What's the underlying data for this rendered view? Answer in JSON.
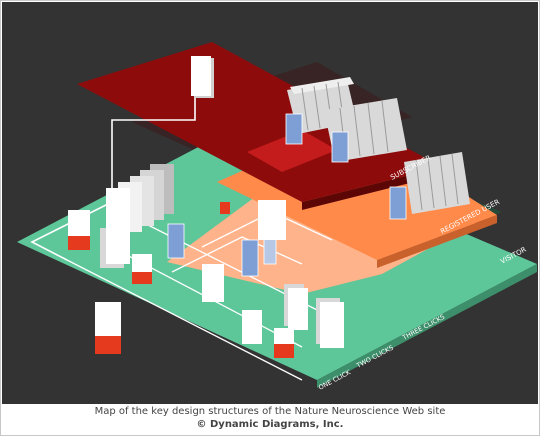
{
  "levels": {
    "visitor": "VISITOR",
    "registered": "REGISTERED USER",
    "subscriber": "SUBSCRIBER"
  },
  "click_depth": {
    "one": "ONE CLICK",
    "two": "TWO CLICKS",
    "three": "THREE CLICKS"
  },
  "caption": {
    "line1": "Map of the key design structures of the Nature Neuroscience Web site",
    "line2": "© Dynamic Diagrams, Inc."
  },
  "colors": {
    "background": "#333333",
    "visitor": "#5ec79a",
    "registered": "#ff8a4a",
    "subscriber": "#8e0b0b",
    "page_accent": "#e63a1e",
    "page_blue": "#7d9fd6"
  }
}
